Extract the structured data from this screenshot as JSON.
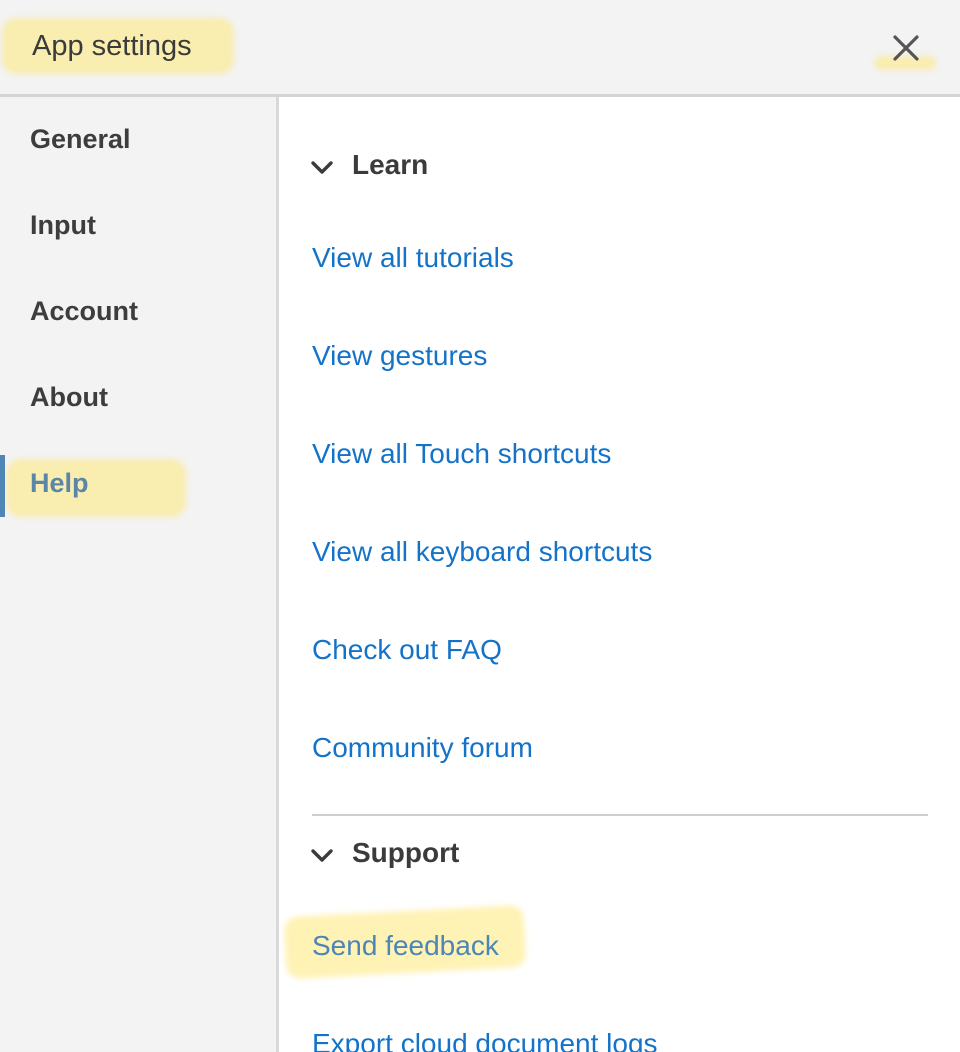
{
  "dialog": {
    "title": "App settings",
    "close_icon": "close-icon"
  },
  "sidebar": {
    "items": [
      {
        "label": "General"
      },
      {
        "label": "Input"
      },
      {
        "label": "Account"
      },
      {
        "label": "About"
      },
      {
        "label": "Help",
        "active": true
      }
    ]
  },
  "content": {
    "learn": {
      "label": "Learn",
      "icon": "chevron-down-icon",
      "links": [
        "View all tutorials",
        "View gestures",
        "View all Touch shortcuts",
        "View all keyboard shortcuts",
        "Check out FAQ",
        "Community forum"
      ]
    },
    "support": {
      "label": "Support",
      "icon": "chevron-down-icon",
      "links": [
        "Send feedback",
        "Export cloud document logs"
      ]
    }
  },
  "colors": {
    "link": "#1473c8",
    "active_nav": "#5a86a8",
    "active_bar": "#4f86b5",
    "highlight": "#ffe878"
  }
}
